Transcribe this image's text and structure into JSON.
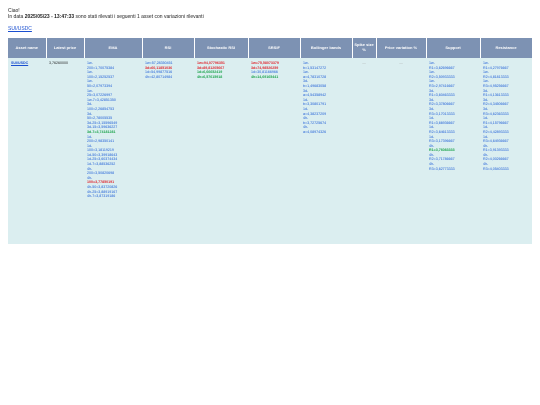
{
  "intro": {
    "greeting": "Ciao!",
    "line_prefix": "In data ",
    "date": "2025\\05\\23 - 13:47:33",
    "line_suffix": " sono stati rilevati i seguenti 1 asset con variazioni rilevanti"
  },
  "asset_link": "SUI/USDC",
  "headers": [
    "Asset name",
    "Latest price",
    "EMA",
    "RSI",
    "Stochastic RSI",
    "SRSIF",
    "Bollinger bands",
    "Spike size %",
    "Price variation %",
    "Support",
    "Resistance"
  ],
  "row": {
    "asset": "SUI/USDC",
    "price": "3,76260000",
    "ema": [
      {
        "t": "1w-"
      },
      {
        "t": "200=1,70075384"
      },
      {
        "t": "1w-"
      },
      {
        "t": "100=2,15252537"
      },
      {
        "t": "1w-"
      },
      {
        "t": "50=2,07973394"
      },
      {
        "t": "1w-"
      },
      {
        "t": "25=3,07226997"
      },
      {
        "t": "1w-7=3,42851350"
      },
      {
        "t": "3d-"
      },
      {
        "t": "100=2,26854753"
      },
      {
        "t": "3d-"
      },
      {
        "t": "50=2,78005535"
      },
      {
        "t": "3d-25=3,15596549"
      },
      {
        "t": "3d-15=3,59636227"
      },
      {
        "t": "3d-7=3,74181281",
        "c": "g"
      },
      {
        "t": "1d-"
      },
      {
        "t": "200=2,98350141"
      },
      {
        "t": "1d-"
      },
      {
        "t": "100=3,18119219"
      },
      {
        "t": "1d-50=3,39918643"
      },
      {
        "t": "1d-25=3,60374434"
      },
      {
        "t": "1d-7=3,88536252"
      },
      {
        "t": "4h-"
      },
      {
        "t": "200=3,50820698"
      },
      {
        "t": "4h-"
      },
      {
        "t": "100=3,77850191",
        "c": "r"
      },
      {
        "t": "4h-50=3,83720826"
      },
      {
        "t": "4h-25=3,88919167"
      },
      {
        "t": "4h-7=3,87319186"
      }
    ],
    "rsi": [
      {
        "t": "1w=57,28350451"
      },
      {
        "t": "3d=60,11851036",
        "c": "r"
      },
      {
        "t": "1d=54,99877516"
      },
      {
        "t": "4h=42,80714984"
      }
    ],
    "stoch": [
      {
        "t": "1w=94,07796351",
        "c": "r"
      },
      {
        "t": "3d=89,81205667",
        "c": "r"
      },
      {
        "t": "1d=6,66652419",
        "c": "g"
      },
      {
        "t": "4h=6,57615918",
        "c": "g"
      }
    ],
    "srsif": [
      {
        "t": "1w=75,58073379",
        "c": "r"
      },
      {
        "t": "3d=74,98526259",
        "c": "r"
      },
      {
        "t": "1d=30,81166966"
      },
      {
        "t": "4h=14,69165441",
        "c": "g"
      }
    ],
    "bollinger": [
      {
        "t": "1w-"
      },
      {
        "t": "b=1,53147272"
      },
      {
        "t": "1w-"
      },
      {
        "t": "a=4,78310728"
      },
      {
        "t": "3d-"
      },
      {
        "t": "b=1,49683058"
      },
      {
        "t": "3d-"
      },
      {
        "t": "a=4,54358942"
      },
      {
        "t": "1d-"
      },
      {
        "t": "b=3,30801791"
      },
      {
        "t": "1d-"
      },
      {
        "t": "a=4,38237209"
      },
      {
        "t": "4h-"
      },
      {
        "t": "b=3,72725674"
      },
      {
        "t": "4h-"
      },
      {
        "t": "a=4,08974326"
      }
    ],
    "spike": "—",
    "variation": "—",
    "support": [
      {
        "t": "1w-"
      },
      {
        "t": "R1=3,62696667"
      },
      {
        "t": "1w-"
      },
      {
        "t": "R2=3,50933333"
      },
      {
        "t": "1w-"
      },
      {
        "t": "R3=2,97416667"
      },
      {
        "t": "3d-"
      },
      {
        "t": "R1=3,60463333"
      },
      {
        "t": "3d-"
      },
      {
        "t": "R2=3,37806667"
      },
      {
        "t": "3d-"
      },
      {
        "t": "R3=3,17013333"
      },
      {
        "t": "1d-"
      },
      {
        "t": "R1=3,66936667"
      },
      {
        "t": "1d-"
      },
      {
        "t": "R2=3,64613333"
      },
      {
        "t": "1d-"
      },
      {
        "t": "R3=3,17396667"
      },
      {
        "t": "4h-"
      },
      {
        "t": "R1=3,76083333",
        "c": "g"
      },
      {
        "t": "4h-"
      },
      {
        "t": "R2=3,71786667"
      },
      {
        "t": "4h-"
      },
      {
        "t": "R3=3,62773333"
      }
    ],
    "resistance": [
      {
        "t": "1w-"
      },
      {
        "t": "R1=4,27976667"
      },
      {
        "t": "1w-"
      },
      {
        "t": "R2=4,81813333"
      },
      {
        "t": "1w-"
      },
      {
        "t": "R3=4,95256667"
      },
      {
        "t": "3d-"
      },
      {
        "t": "R1=4,13613333"
      },
      {
        "t": "3d-"
      },
      {
        "t": "R2=4,34506667"
      },
      {
        "t": "3d-"
      },
      {
        "t": "R3=4,62363333"
      },
      {
        "t": "1d-"
      },
      {
        "t": "R1=4,15796667"
      },
      {
        "t": "1d-"
      },
      {
        "t": "R2=4,42893333"
      },
      {
        "t": "1d-"
      },
      {
        "t": "R3=4,64936667"
      },
      {
        "t": "4h-"
      },
      {
        "t": "R1=3,91393333"
      },
      {
        "t": "4h-"
      },
      {
        "t": "R2=4,00266667"
      },
      {
        "t": "4h-"
      },
      {
        "t": "R3=4,05403333"
      }
    ]
  }
}
